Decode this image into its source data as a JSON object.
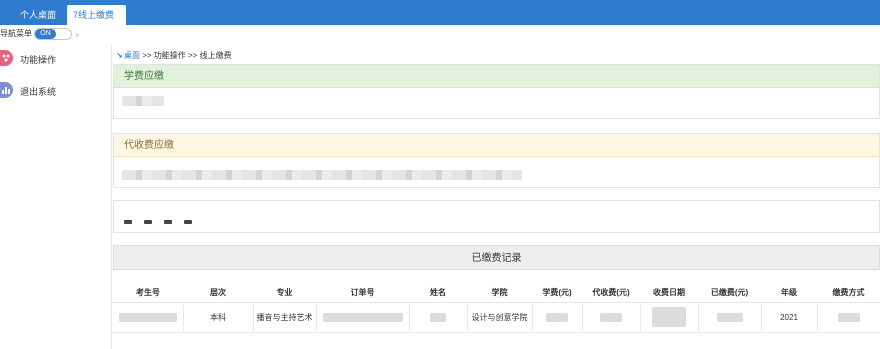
{
  "tabs": [
    {
      "label": "个人桌面"
    },
    {
      "label": "7线上缴费",
      "close": "×"
    }
  ],
  "nav": {
    "label": "导航菜单",
    "toggle": "ON"
  },
  "sidebar": {
    "items": [
      {
        "label": "功能操作",
        "icon": "function-icon",
        "color": "#e8617f"
      },
      {
        "label": "退出系统",
        "icon": "chart-icon",
        "color": "#7b8fd6"
      }
    ]
  },
  "breadcrumb": {
    "home": "桌面",
    "rest": " >> 功能操作 >> 线上缴费"
  },
  "tuition_panel": {
    "title": "学费应缴"
  },
  "agency_panel": {
    "title": "代收费应缴"
  },
  "records": {
    "title": "已缴费记录",
    "columns": [
      "考生号",
      "层次",
      "专业",
      "订单号",
      "姓名",
      "学院",
      "学费(元)",
      "代收费(元)",
      "收费日期",
      "已缴费(元)",
      "年级",
      "缴费方式"
    ],
    "row": {
      "level": "本科",
      "major": "播音与主持艺术",
      "college": "设计与创意学院",
      "grade": "2021"
    }
  },
  "colors": {
    "brand": "#2f7ccf",
    "success_bg": "#e3f1dc",
    "warning_bg": "#fcf6e3"
  }
}
